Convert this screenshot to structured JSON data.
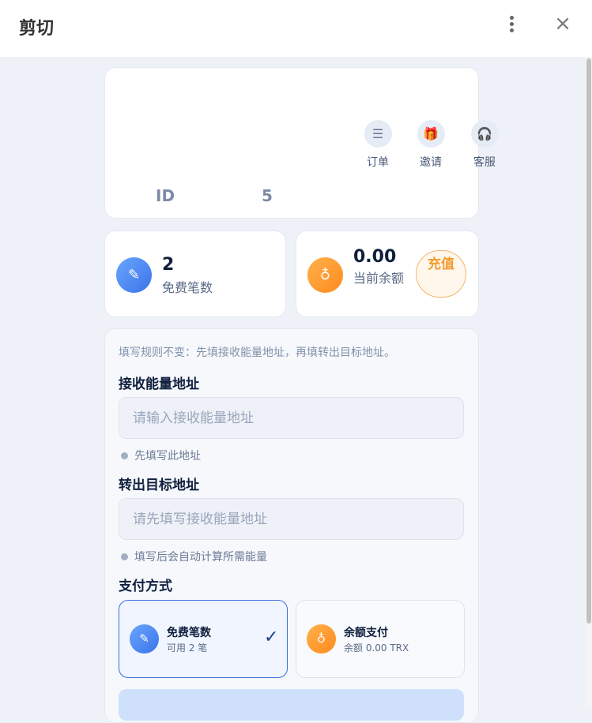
{
  "header": {
    "title": "剪切"
  },
  "account": {
    "quick_links": [
      {
        "label": "订单",
        "icon": "list-icon",
        "glyph": "☰"
      },
      {
        "label": "邀请",
        "icon": "gift-icon",
        "glyph": "🎁"
      },
      {
        "label": "客服",
        "icon": "headset-icon",
        "glyph": "🎧"
      }
    ],
    "id_label": "ID",
    "id_value": "5"
  },
  "stats": {
    "free_count": "2",
    "free_label": "免费笔数",
    "balance": "0.00",
    "balance_label": "当前余额",
    "recharge_label": "充值"
  },
  "form": {
    "rule_text": "填写规则不变：先填接收能量地址，再填转出目标地址。",
    "receive_title": "接收能量地址",
    "receive_placeholder": "请输入接收能量地址",
    "receive_hint": "先填写此地址",
    "target_title": "转出目标地址",
    "target_placeholder": "请先填写接收能量地址",
    "target_hint": "填写后会自动计算所需能量",
    "payment_title": "支付方式",
    "payment_options": [
      {
        "title": "免费笔数",
        "sub": "可用 2 笔",
        "selected": true,
        "icon": "pencil-icon"
      },
      {
        "title": "余额支付",
        "sub": "余额 0.00 TRX",
        "selected": false,
        "icon": "coin-bag-icon"
      }
    ]
  },
  "colors": {
    "accent_blue": "#3a74e8",
    "accent_orange": "#ff8a1e",
    "page_bg": "#eef2f8"
  }
}
